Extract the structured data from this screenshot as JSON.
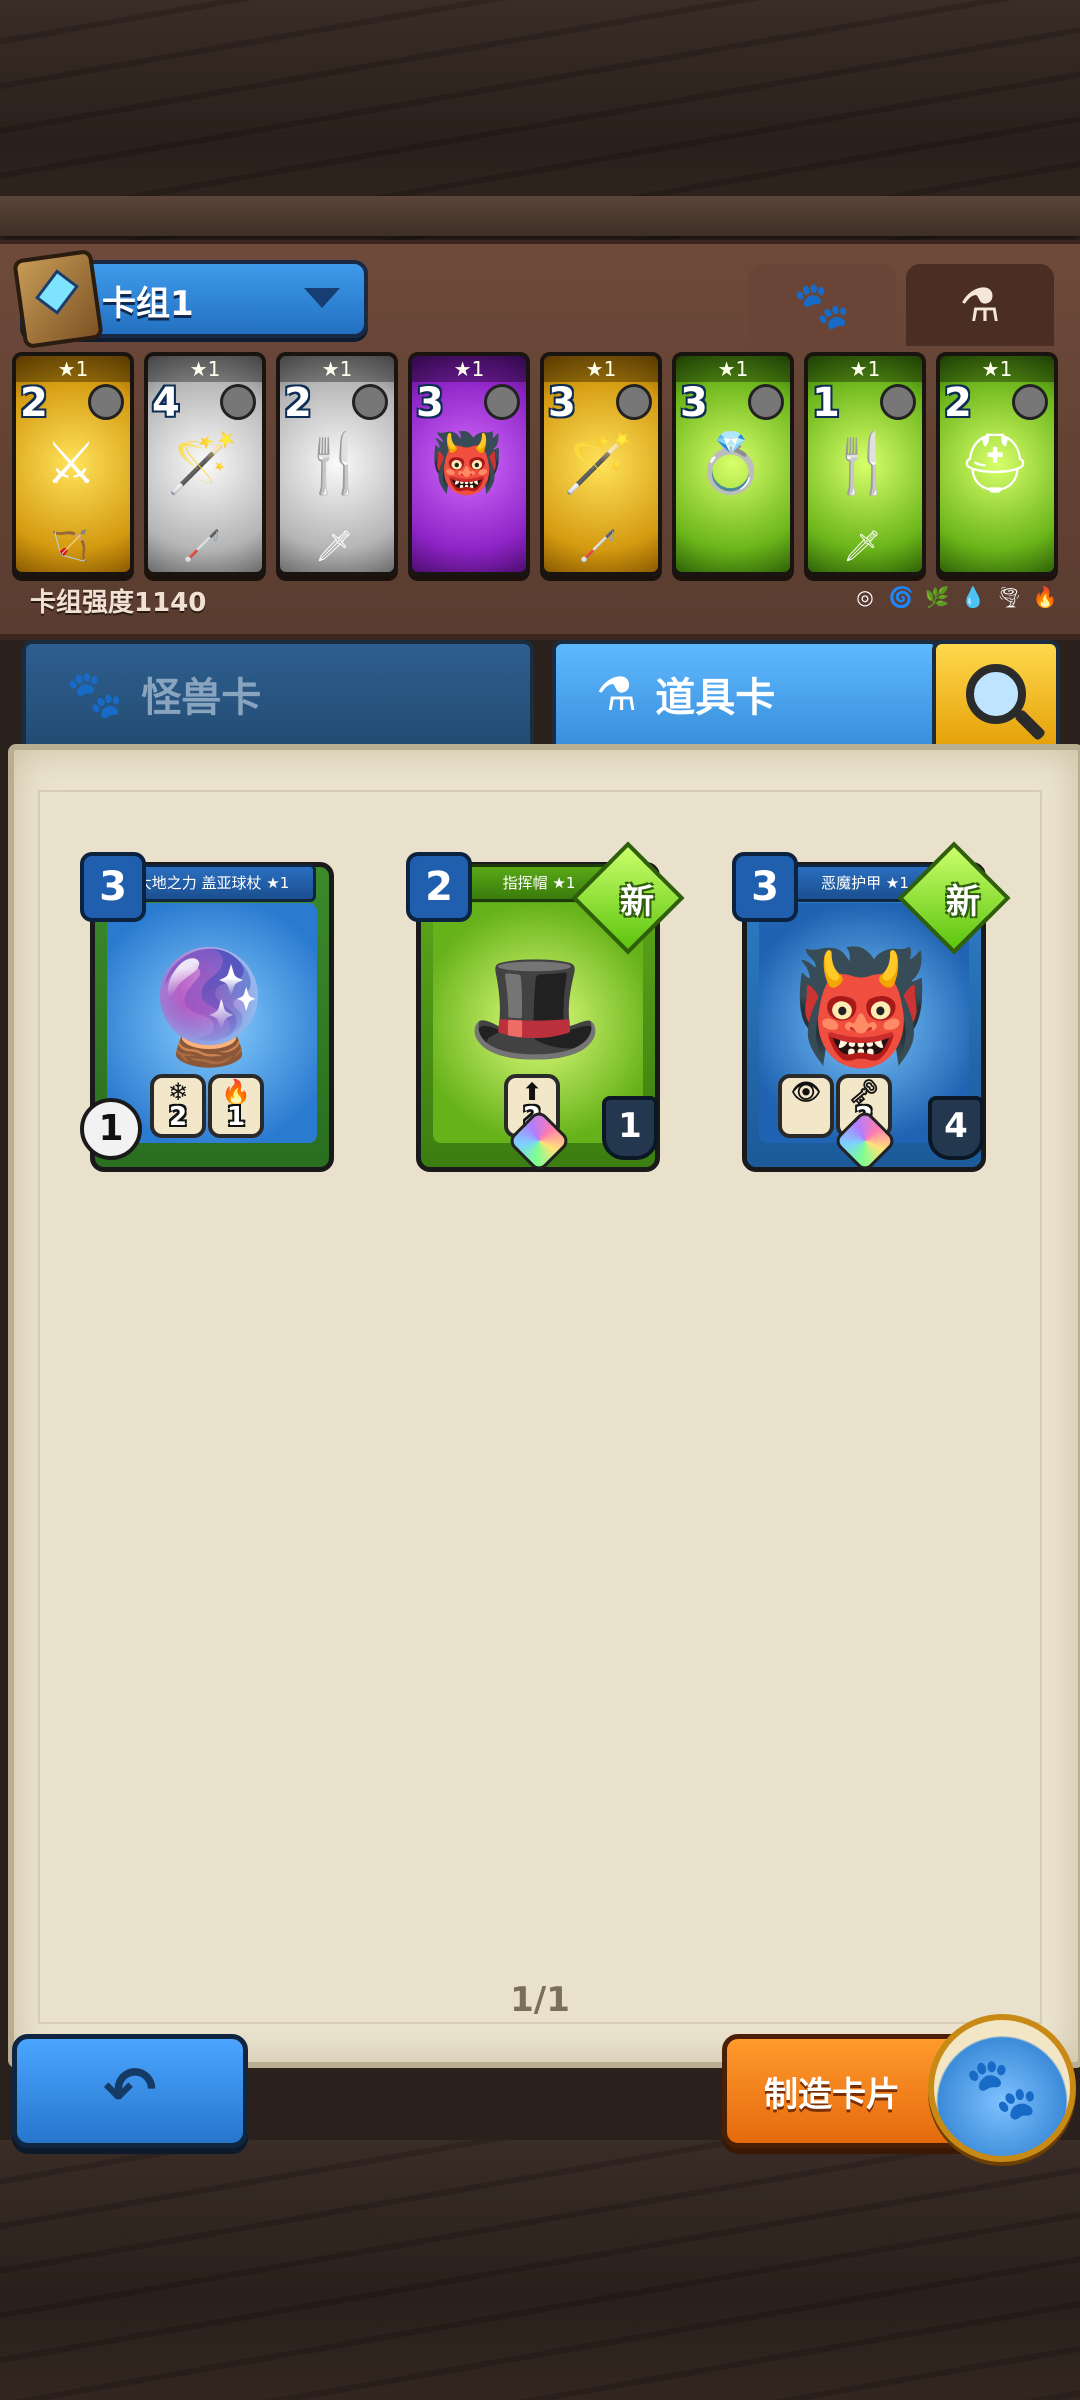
{
  "deck": {
    "name": "卡组1",
    "strength_label": "卡组强度1140"
  },
  "deck_cards": [
    {
      "stars": "★1",
      "cost": "2",
      "color": "gold",
      "art": "⚔",
      "tag": "🏹"
    },
    {
      "stars": "★1",
      "cost": "4",
      "color": "silver",
      "art": "🪄",
      "tag": "🦯"
    },
    {
      "stars": "★1",
      "cost": "2",
      "color": "silver",
      "art": "🍴",
      "tag": "🗡"
    },
    {
      "stars": "★1",
      "cost": "3",
      "color": "purple",
      "art": "👹",
      "tag": ""
    },
    {
      "stars": "★1",
      "cost": "3",
      "color": "gold",
      "art": "🪄",
      "tag": "🦯"
    },
    {
      "stars": "★1",
      "cost": "3",
      "color": "green",
      "art": "💍",
      "tag": ""
    },
    {
      "stars": "★1",
      "cost": "1",
      "color": "green",
      "art": "🍴",
      "tag": "🗡"
    },
    {
      "stars": "★1",
      "cost": "2",
      "color": "green",
      "art": "⛑",
      "tag": ""
    }
  ],
  "elements": [
    "◎",
    "🌀",
    "🌿",
    "💧",
    "🌪",
    "🔥"
  ],
  "tabs": {
    "beast": "怪兽卡",
    "item": "道具卡"
  },
  "cards": [
    {
      "name": "大地之力 盖亚球杖 ★1",
      "cost": "3",
      "art": "🔮",
      "stat1": "2",
      "stat2": "1",
      "level": "1",
      "badge": ""
    },
    {
      "name": "指挥帽 ★1",
      "cost": "2",
      "art": "🎩",
      "stat1": "2",
      "shield": "1",
      "badge": "新"
    },
    {
      "name": "恶魔护甲 ★1",
      "cost": "3",
      "art": "👹",
      "stat1": "2",
      "shield": "4",
      "badge": "新"
    }
  ],
  "pager": "1/1",
  "buttons": {
    "craft": "制造卡片"
  }
}
